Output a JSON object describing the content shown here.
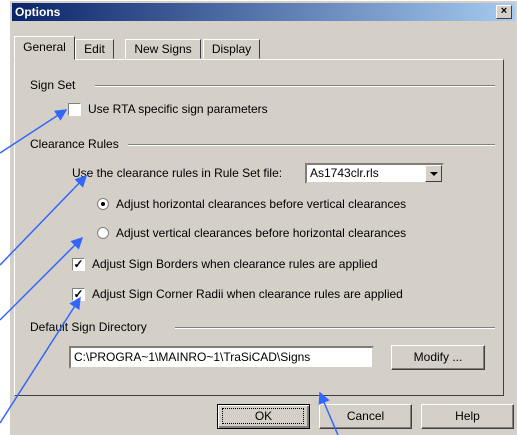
{
  "window": {
    "title": "Options",
    "close_label": "×"
  },
  "tabs": [
    {
      "label": "General",
      "active": true
    },
    {
      "label": "Edit",
      "active": false
    },
    {
      "label": "New Signs",
      "active": false
    },
    {
      "label": "Display",
      "active": false
    }
  ],
  "sign_set": {
    "group_label": "Sign Set",
    "use_rta_label": "Use RTA specific sign parameters",
    "use_rta_checked": false
  },
  "clearance_rules": {
    "group_label": "Clearance Rules",
    "rule_set_label": "Use the clearance rules in Rule Set file:",
    "rule_set_value": "As1743clr.rls",
    "radio_horizontal_label": "Adjust horizontal clearances before vertical clearances",
    "radio_vertical_label": "Adjust vertical clearances before horizontal clearances",
    "selected_radio": "horizontal",
    "adjust_borders_label": "Adjust Sign Borders when clearance rules are applied",
    "adjust_borders_checked": true,
    "adjust_radii_label": "Adjust Sign Corner Radii when clearance rules are applied",
    "adjust_radii_checked": true
  },
  "directory": {
    "group_label": "Default Sign Directory",
    "path_value": "C:\\PROGRA~1\\MAINRO~1\\TraSiCAD\\Signs",
    "modify_label": "Modify ..."
  },
  "footer": {
    "ok_label": "OK",
    "cancel_label": "Cancel",
    "help_label": "Help"
  },
  "colors": {
    "dialog_face": "#d4d0c8",
    "title_start": "#0a246a",
    "title_end": "#a6caf0",
    "annotation_arrow": "#3366ff"
  }
}
